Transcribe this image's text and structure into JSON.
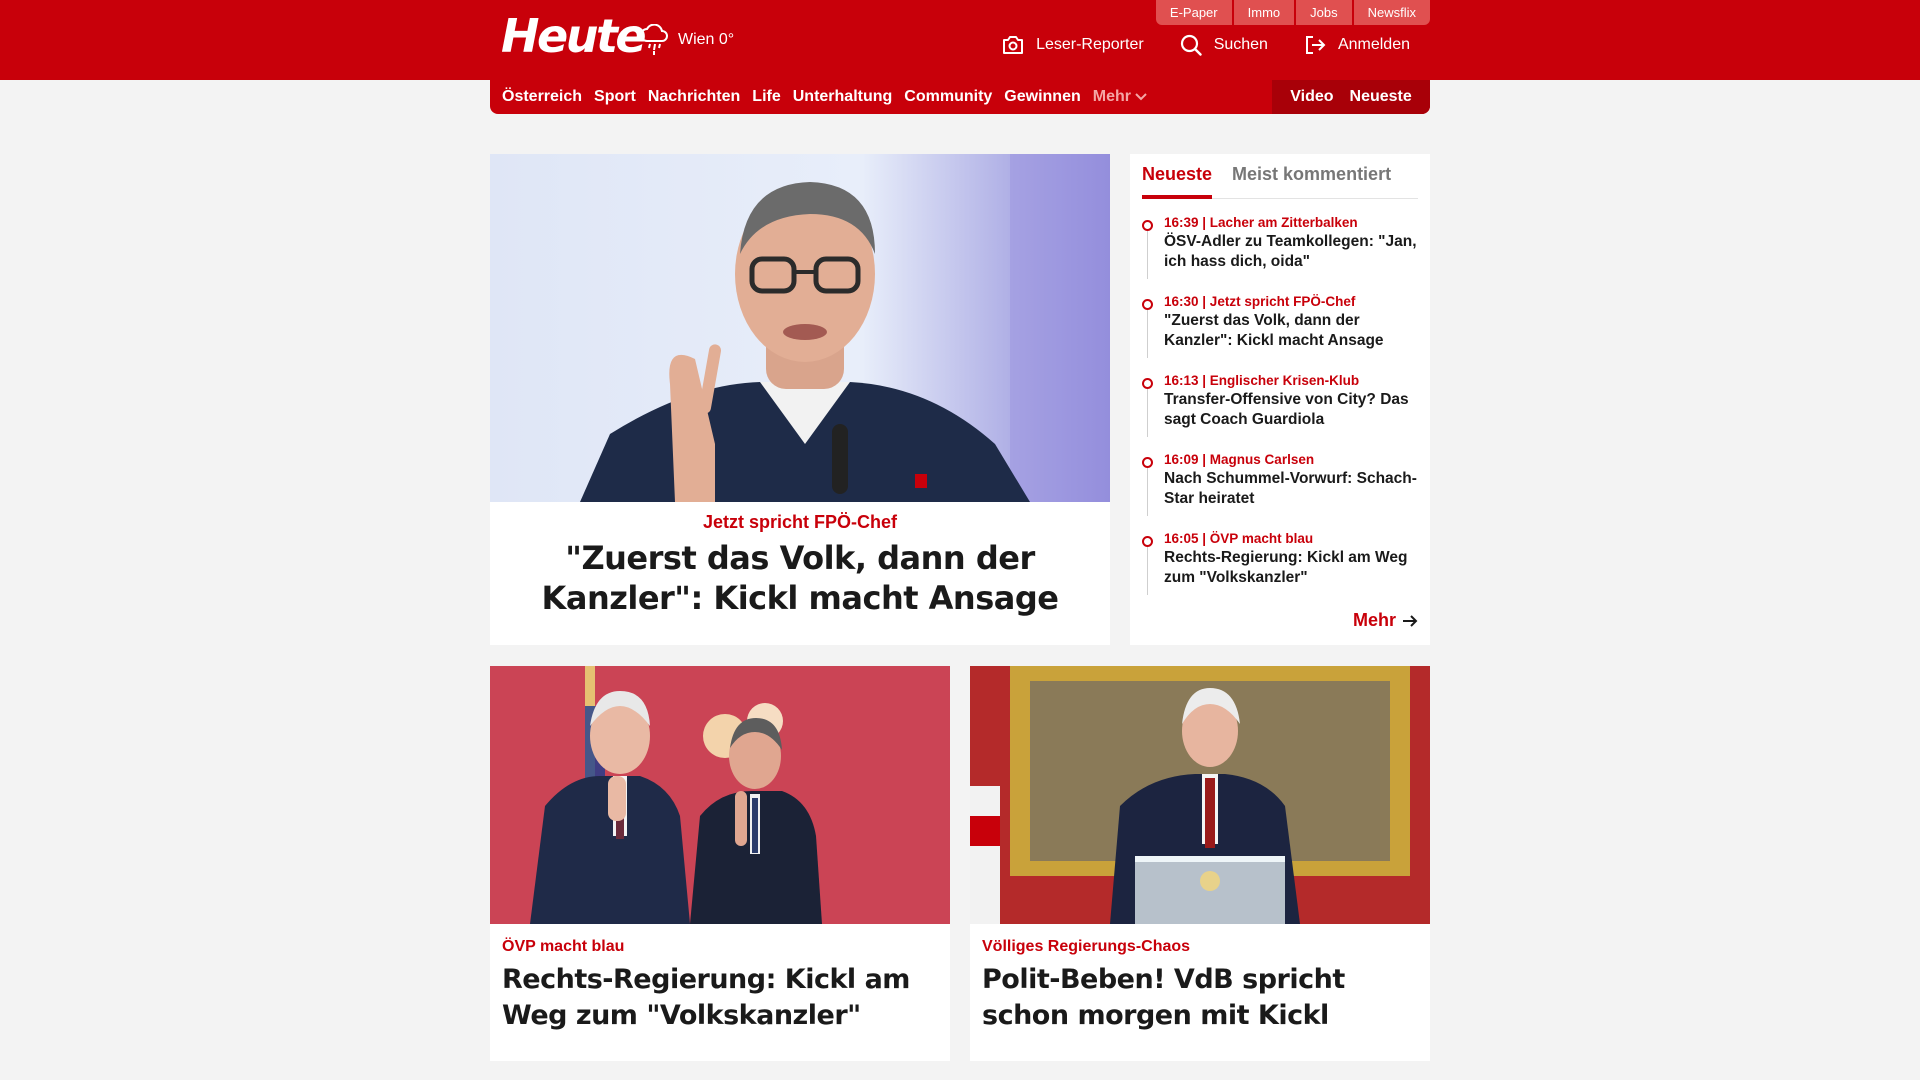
{
  "brand": {
    "logo": "Heute",
    "accent": "#c8000a"
  },
  "weather": {
    "icon": "weather-rain-icon",
    "text": "Wien 0°"
  },
  "top_menu": [
    "E-Paper",
    "Immo",
    "Jobs",
    "Newsflix"
  ],
  "header_actions": {
    "reporter": "Leser-Reporter",
    "search": "Suchen",
    "login": "Anmelden"
  },
  "nav": {
    "items": [
      "Österreich",
      "Sport",
      "Nachrichten",
      "Life",
      "Unterhaltung",
      "Community",
      "Gewinnen"
    ],
    "more": "Mehr",
    "video": "Video",
    "latest": "Neueste"
  },
  "hero": {
    "kicker": "Jetzt spricht FPÖ-Chef",
    "title": "\"Zuerst das Volk, dann der Kanzler\": Kickl macht Ansage"
  },
  "sidebar": {
    "tabs": [
      "Neueste",
      "Meist kommentiert"
    ],
    "items": [
      {
        "meta": "16:39 | Lacher am Zitterbalken",
        "title": "ÖSV-Adler zu Teamkollegen: \"Jan, ich hass dich, oida\""
      },
      {
        "meta": "16:30 | Jetzt spricht FPÖ-Chef",
        "title": "\"Zuerst das Volk, dann der Kanzler\": Kickl macht Ansage"
      },
      {
        "meta": "16:13 | Englischer Krisen-Klub",
        "title": "Transfer-Offensive von City? Das sagt Coach Guardiola"
      },
      {
        "meta": "16:09 | Magnus Carlsen",
        "title": "Nach Schummel-Vorwurf: Schach-Star heiratet"
      },
      {
        "meta": "16:05 | ÖVP macht blau",
        "title": "Rechts-Regierung: Kickl am Weg zum \"Volkskanzler\""
      }
    ],
    "more": "Mehr"
  },
  "cards": [
    {
      "kicker": "ÖVP macht blau",
      "title": "Rechts-Regierung: Kickl am Weg zum \"Volkskanzler\""
    },
    {
      "kicker": "Völliges Regierungs-Chaos",
      "title": "Polit-Beben! VdB spricht schon morgen mit Kickl"
    }
  ]
}
